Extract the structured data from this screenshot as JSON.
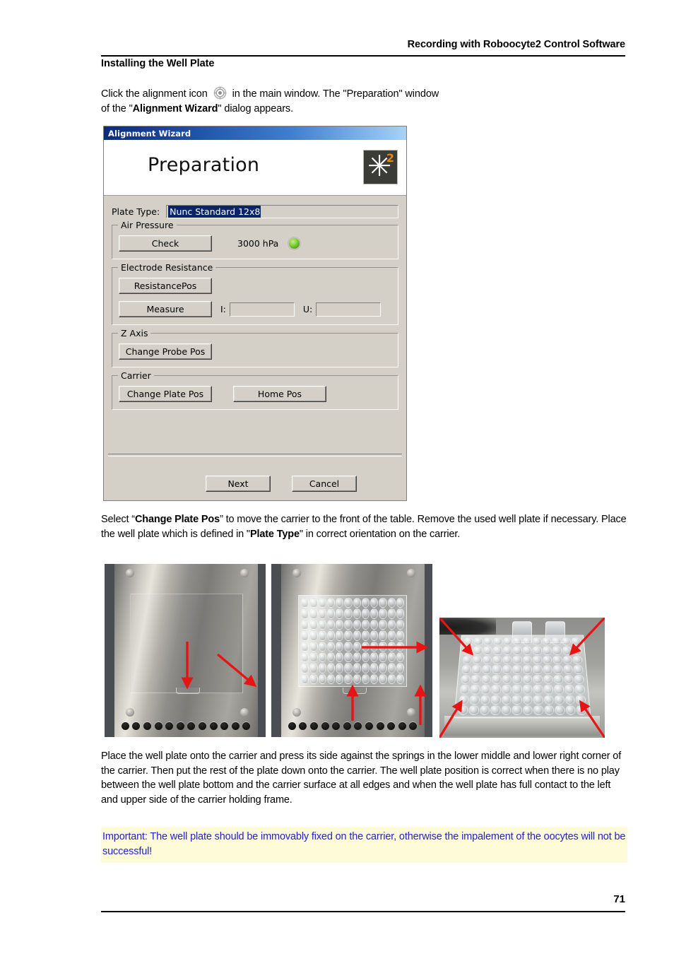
{
  "page": {
    "running_header": "Recording with Roboocyte2 Control Software",
    "section_title": "Installing the Well Plate",
    "page_number": "71"
  },
  "intro": {
    "text_before_icon": "Click the alignment icon",
    "icon_name": "alignment-target-icon",
    "text_after_icon": " in the main window. The \"Preparation\" window",
    "line2_before_bold": "of the \"",
    "line2_bold": "Alignment Wizard",
    "line2_after_bold": "\" dialog appears."
  },
  "dialog": {
    "title": "Alignment Wizard",
    "banner_title": "Preparation",
    "logo": {
      "glyph": "✳",
      "superscript": "2",
      "background": "#3b3b38",
      "superscript_color": "#e8880e"
    },
    "plate_type": {
      "label": "Plate Type:",
      "value": "Nunc Standard 12x8",
      "selection_color": "#0a246a"
    },
    "air_pressure": {
      "legend": "Air Pressure",
      "check_button": "Check",
      "value": "3000 hPa",
      "led_color": "#86d53c"
    },
    "electrode_resistance": {
      "legend": "Electrode Resistance",
      "resistance_pos_button": "ResistancePos",
      "measure_button": "Measure",
      "current_label": "I:",
      "current_value": "",
      "voltage_label": "U:",
      "voltage_value": ""
    },
    "z_axis": {
      "legend": "Z Axis",
      "change_probe_pos_button": "Change Probe Pos"
    },
    "carrier": {
      "legend": "Carrier",
      "change_plate_pos_button": "Change Plate Pos",
      "home_pos_button": "Home Pos"
    },
    "footer": {
      "next_button": "Next",
      "cancel_button": "Cancel"
    }
  },
  "mid_paragraph": {
    "part1": "Select “",
    "bold1": "Change Plate Pos",
    "part2": "” to move the carrier to the front of the table. Remove the used well plate if necessary. Place the well plate which is defined in \"",
    "bold2": "Plate Type",
    "part3": "\" in correct orientation on the carrier."
  },
  "photos": [
    {
      "name": "empty-carrier-photo",
      "caption": "Empty metal carrier plate with arrows pointing to lower middle and lower right springs"
    },
    {
      "name": "installed-plate-photo",
      "caption": "96-well plate installed on carrier, arrows indicating contact to left and upper side"
    },
    {
      "name": "angled-plate-photo",
      "caption": "Angled view of the well plate with four corner arrows"
    }
  ],
  "low_paragraph": "Place the well plate onto the carrier and press its side against the springs in the lower middle and lower right corner of the carrier. Then put the rest of the plate down onto the carrier. The well plate position is correct when there is no play between the well plate bottom and the carrier surface at all edges and when the well plate has full contact to the left and upper side of the carrier holding frame.",
  "note": {
    "text": "Important: The well plate should be immovably fixed on the carrier, otherwise the impalement of the oocytes will not be successful!",
    "text_color": "#2222cc",
    "background_color": "#fdfbd8"
  }
}
